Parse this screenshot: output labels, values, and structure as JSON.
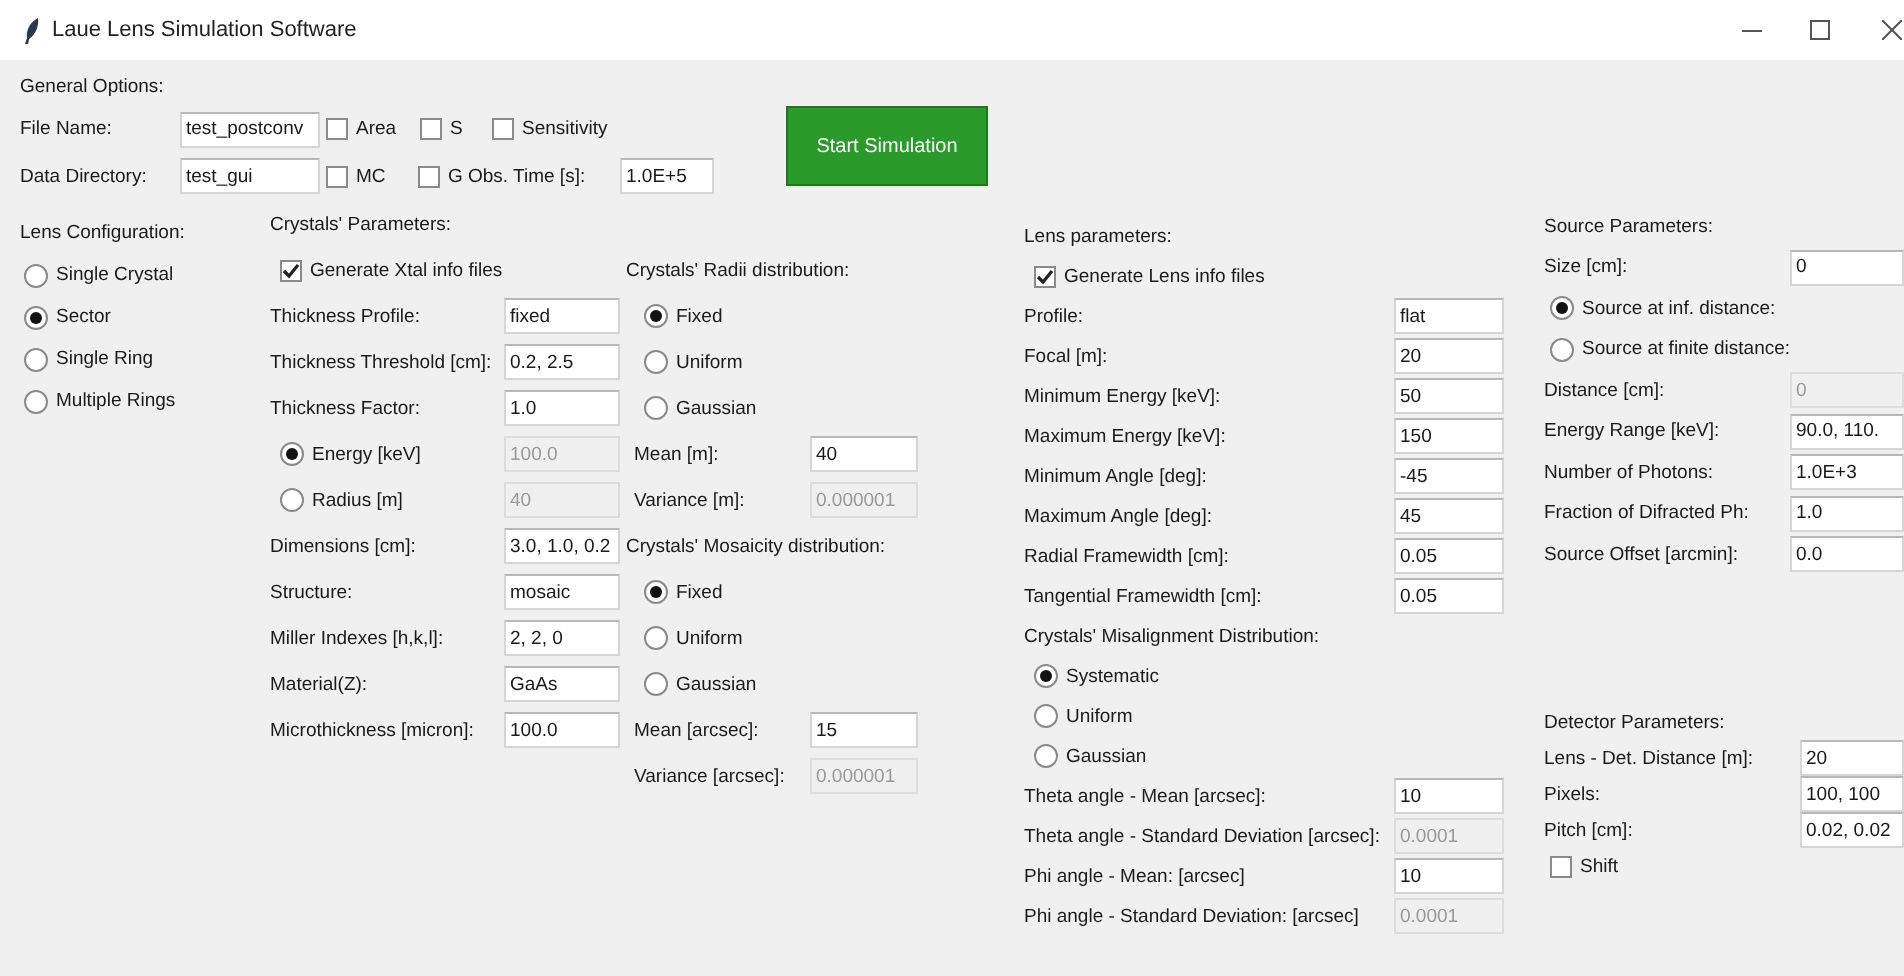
{
  "window": {
    "title": "Laue Lens Simulation Software"
  },
  "general_options": {
    "title": "General Options:",
    "file_name": {
      "label": "File Name:",
      "value": "test_postconv"
    },
    "data_directory": {
      "label": "Data Directory:",
      "value": "test_gui"
    },
    "options_row_1": [
      {
        "label": "Area",
        "checked": false
      },
      {
        "label": "S",
        "checked": false
      },
      {
        "label": "Sensitivity",
        "checked": false
      }
    ],
    "options_row_2": [
      {
        "label": "MC",
        "checked": false
      },
      {
        "label": "G",
        "checked": false
      }
    ],
    "obs_time": {
      "label": "Obs. Time [s]:",
      "value": "1.0E+5"
    },
    "start_button": "Start Simulation"
  },
  "panels": [
    {
      "sections": [
        {
          "items": [
            {
              "kind": "heading",
              "label": "Lens Configuration:"
            },
            {
              "kind": "radio",
              "label": "Single Crystal",
              "selected": false
            },
            {
              "kind": "radio",
              "label": "Sector",
              "selected": true
            },
            {
              "kind": "radio",
              "label": "Single Ring",
              "selected": false
            },
            {
              "kind": "radio",
              "label": "Multiple Rings",
              "selected": false
            }
          ]
        }
      ]
    },
    {
      "sections": [
        {
          "items": [
            {
              "kind": "heading",
              "label": "Crystals' Parameters:"
            },
            {
              "kind": "check",
              "label": "Generate Xtal info files",
              "checked": true
            },
            {
              "kind": "field",
              "label": "Thickness Profile:",
              "value": "fixed",
              "disabled": false
            },
            {
              "kind": "field",
              "label": "Thickness Threshold [cm]:",
              "value": "0.2, 2.5",
              "disabled": false
            },
            {
              "kind": "field",
              "label": "Thickness Factor:",
              "value": "1.0",
              "disabled": false
            },
            {
              "kind": "radio_field",
              "label": "Energy [keV]",
              "selected": true,
              "value": "100.0",
              "disabled": true
            },
            {
              "kind": "radio_field",
              "label": "Radius [m]",
              "selected": false,
              "value": "40",
              "disabled": true
            },
            {
              "kind": "field",
              "label": "Dimensions [cm]:",
              "value": "3.0, 1.0, 0.2",
              "disabled": false
            },
            {
              "kind": "field",
              "label": "Structure:",
              "value": "mosaic",
              "disabled": false
            },
            {
              "kind": "field",
              "label": "Miller Indexes [h,k,l]:",
              "value": "2, 2, 0",
              "disabled": false
            },
            {
              "kind": "field",
              "label": "Material(Z):",
              "value": "GaAs",
              "disabled": false
            },
            {
              "kind": "field",
              "label": "Microthickness [micron]:",
              "value": "100.0",
              "disabled": false
            }
          ]
        }
      ]
    },
    {
      "sections": [
        {
          "items": [
            {
              "kind": "heading",
              "label": "Crystals' Radii distribution:"
            },
            {
              "kind": "radio",
              "label": "Fixed",
              "selected": true
            },
            {
              "kind": "radio",
              "label": "Uniform",
              "selected": false
            },
            {
              "kind": "radio",
              "label": "Gaussian",
              "selected": false
            },
            {
              "kind": "field",
              "label": "Mean [m]:",
              "value": "40",
              "disabled": false
            },
            {
              "kind": "field",
              "label": "Variance [m]:",
              "value": "0.000001",
              "disabled": true
            },
            {
              "kind": "heading",
              "label": "Crystals' Mosaicity distribution:"
            },
            {
              "kind": "radio",
              "label": "Fixed",
              "selected": true
            },
            {
              "kind": "radio",
              "label": "Uniform",
              "selected": false
            },
            {
              "kind": "radio",
              "label": "Gaussian",
              "selected": false
            },
            {
              "kind": "field",
              "label": "Mean [arcsec]:",
              "value": "15",
              "disabled": false
            },
            {
              "kind": "field",
              "label": "Variance [arcsec]:",
              "value": "0.000001",
              "disabled": true
            }
          ]
        }
      ]
    },
    {
      "sections": [
        {
          "items": [
            {
              "kind": "heading",
              "label": "Lens parameters:"
            },
            {
              "kind": "check",
              "label": "Generate Lens info files",
              "checked": true
            },
            {
              "kind": "field",
              "label": "Profile:",
              "value": "flat",
              "disabled": false
            },
            {
              "kind": "field",
              "label": "Focal [m]:",
              "value": "20",
              "disabled": false
            },
            {
              "kind": "field",
              "label": "Minimum Energy [keV]:",
              "value": "50",
              "disabled": false
            },
            {
              "kind": "field",
              "label": "Maximum Energy [keV]:",
              "value": "150",
              "disabled": false
            },
            {
              "kind": "field",
              "label": "Minimum Angle [deg]:",
              "value": "-45",
              "disabled": false
            },
            {
              "kind": "field",
              "label": "Maximum Angle [deg]:",
              "value": "45",
              "disabled": false
            },
            {
              "kind": "field",
              "label": "Radial Framewidth [cm]:",
              "value": "0.05",
              "disabled": false
            },
            {
              "kind": "field",
              "label": "Tangential Framewidth [cm]:",
              "value": "0.05",
              "disabled": false
            },
            {
              "kind": "heading",
              "label": "Crystals' Misalignment Distribution:"
            },
            {
              "kind": "radio",
              "label": "Systematic",
              "selected": true
            },
            {
              "kind": "radio",
              "label": "Uniform",
              "selected": false
            },
            {
              "kind": "radio",
              "label": "Gaussian",
              "selected": false
            },
            {
              "kind": "field",
              "label": "Theta angle - Mean [arcsec]:",
              "value": "10",
              "disabled": false
            },
            {
              "kind": "field",
              "label": "Theta angle - Standard Deviation [arcsec]:",
              "value": "0.0001",
              "disabled": true
            },
            {
              "kind": "field",
              "label": "Phi angle - Mean: [arcsec]",
              "value": "10",
              "disabled": false
            },
            {
              "kind": "field",
              "label": "Phi angle - Standard Deviation: [arcsec]",
              "value": "0.0001",
              "disabled": true
            }
          ]
        }
      ]
    },
    {
      "sections": [
        {
          "items": [
            {
              "kind": "heading",
              "label": "Source Parameters:"
            },
            {
              "kind": "field",
              "label": "Size [cm]:",
              "value": "0",
              "disabled": false
            },
            {
              "kind": "radio",
              "label": "Source at inf. distance:",
              "selected": true
            },
            {
              "kind": "radio",
              "label": "Source at finite distance:",
              "selected": false
            },
            {
              "kind": "field",
              "label": "Distance [cm]:",
              "value": "0",
              "disabled": true
            },
            {
              "kind": "field",
              "label": "Energy Range [keV]:",
              "value": "90.0, 110.",
              "disabled": false
            },
            {
              "kind": "field",
              "label": "Number of Photons:",
              "value": "1.0E+3",
              "disabled": false
            },
            {
              "kind": "field",
              "label": "Fraction of Difracted Ph:",
              "value": "1.0",
              "disabled": false
            },
            {
              "kind": "field",
              "label": "Source Offset [arcmin]:",
              "value": "0.0",
              "disabled": false
            }
          ]
        },
        {
          "items": [
            {
              "kind": "heading",
              "label": "Detector Parameters:"
            },
            {
              "kind": "field",
              "label": "Lens - Det. Distance [m]:",
              "value": "20",
              "disabled": false
            },
            {
              "kind": "field",
              "label": "Pixels:",
              "value": "100, 100",
              "disabled": false
            },
            {
              "kind": "field",
              "label": "Pitch [cm]:",
              "value": "0.02, 0.02",
              "disabled": false
            },
            {
              "kind": "check",
              "label": "Shift",
              "checked": false
            }
          ]
        }
      ]
    }
  ]
}
